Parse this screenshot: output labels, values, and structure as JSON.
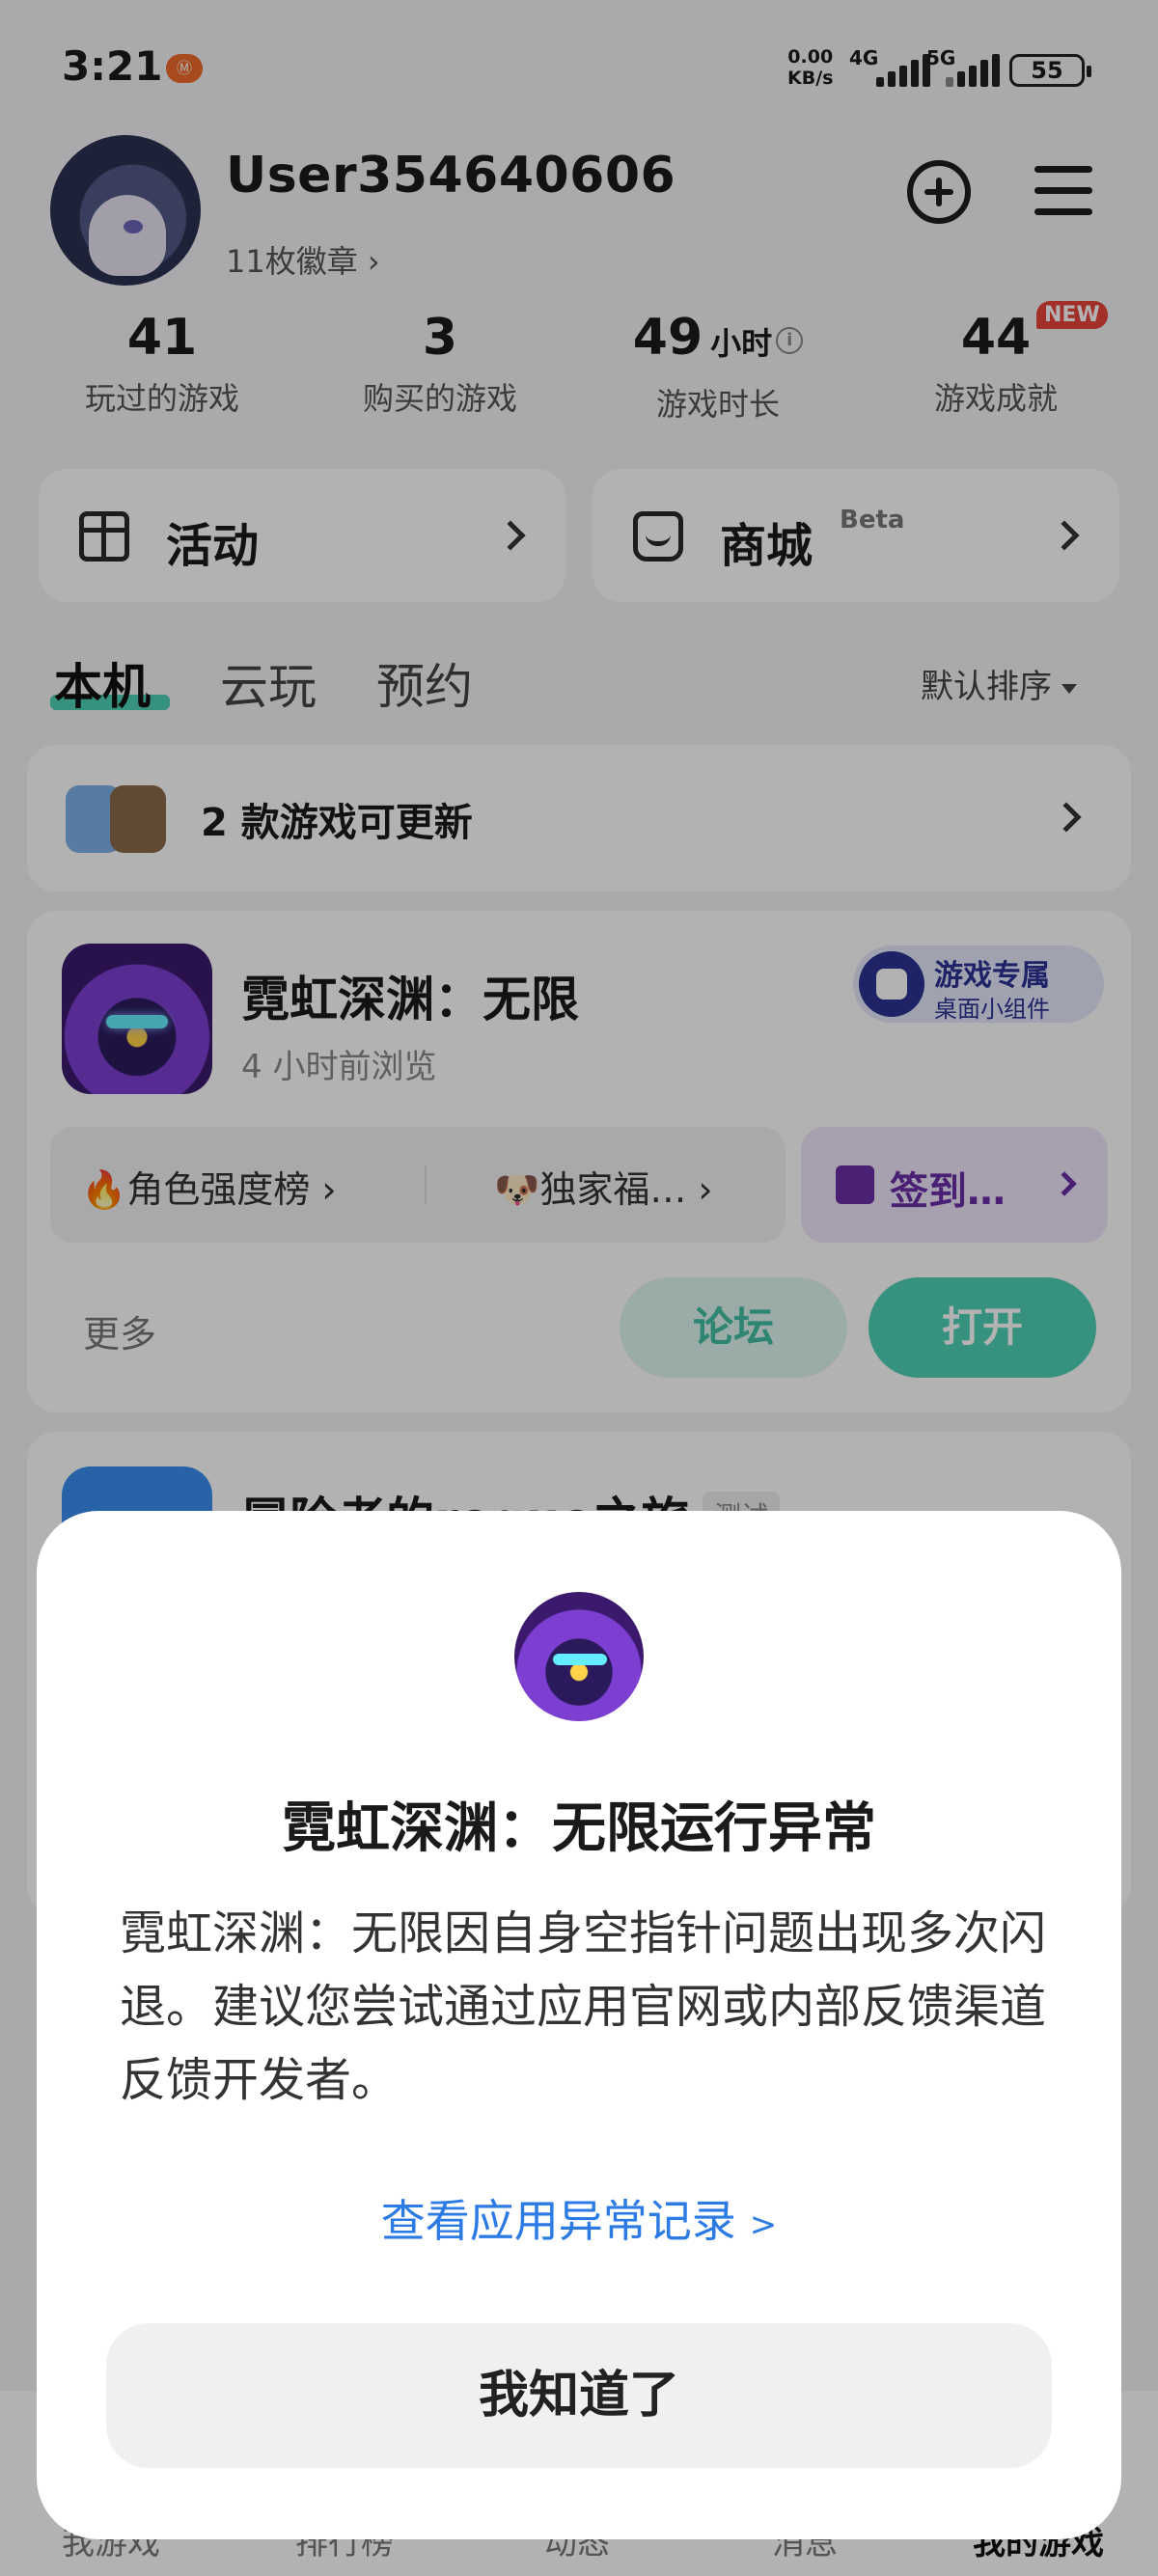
{
  "status_bar": {
    "time": "3:21",
    "notif_badge": "Ⓜ",
    "net_speed_value": "0.00",
    "net_speed_unit": "KB/s",
    "net1": "4G",
    "net2": "5G",
    "battery": "55"
  },
  "profile": {
    "username": "User354640606",
    "badges": "11枚徽章 ›"
  },
  "header_icons": [
    "add-circle-icon",
    "menu-icon"
  ],
  "stats": [
    {
      "value": "41",
      "unit": "",
      "label": "玩过的游戏"
    },
    {
      "value": "3",
      "unit": "",
      "label": "购买的游戏"
    },
    {
      "value": "49",
      "unit": "小时",
      "label": "游戏时长"
    },
    {
      "value": "44",
      "unit": "",
      "label": "游戏成就",
      "badge": "NEW"
    }
  ],
  "actions": {
    "events_label": "活动",
    "store_label": "商城",
    "store_beta": "Beta"
  },
  "tabs": {
    "local": "本机",
    "cloud": "云玩",
    "reserve": "预约",
    "sort": "默认排序"
  },
  "update_card": {
    "text": "2 款游戏可更新"
  },
  "game_card": {
    "name": "霓虹深渊：无限",
    "last_viewed": "4 小时前浏览",
    "widget_title": "游戏专属",
    "widget_sub": "桌面小组件",
    "feature1": "🔥角色强度榜",
    "feature2": "🐶独家福…",
    "signin": "签到…",
    "more": "更多",
    "forum": "论坛",
    "open": "打开"
  },
  "next_card": {
    "name": "冒险者的rogue之旅",
    "tag": "测试"
  },
  "bottom_nav": [
    "我游戏",
    "排行榜",
    "动态",
    "消息",
    "我的游戏"
  ],
  "dialog": {
    "title": "霓虹深渊：无限运行异常",
    "body": "霓虹深渊：无限因自身空指针问题出现多次闪退。建议您尝试通过应用官网或内部反馈渠道反馈开发者。",
    "link": "查看应用异常记录",
    "link_arrow": ">",
    "confirm": "我知道了"
  },
  "colors": {
    "accent": "#4ed2b6",
    "link": "#2c7be5",
    "new_badge": "#e8463c",
    "signin": "#6a2fa8"
  }
}
